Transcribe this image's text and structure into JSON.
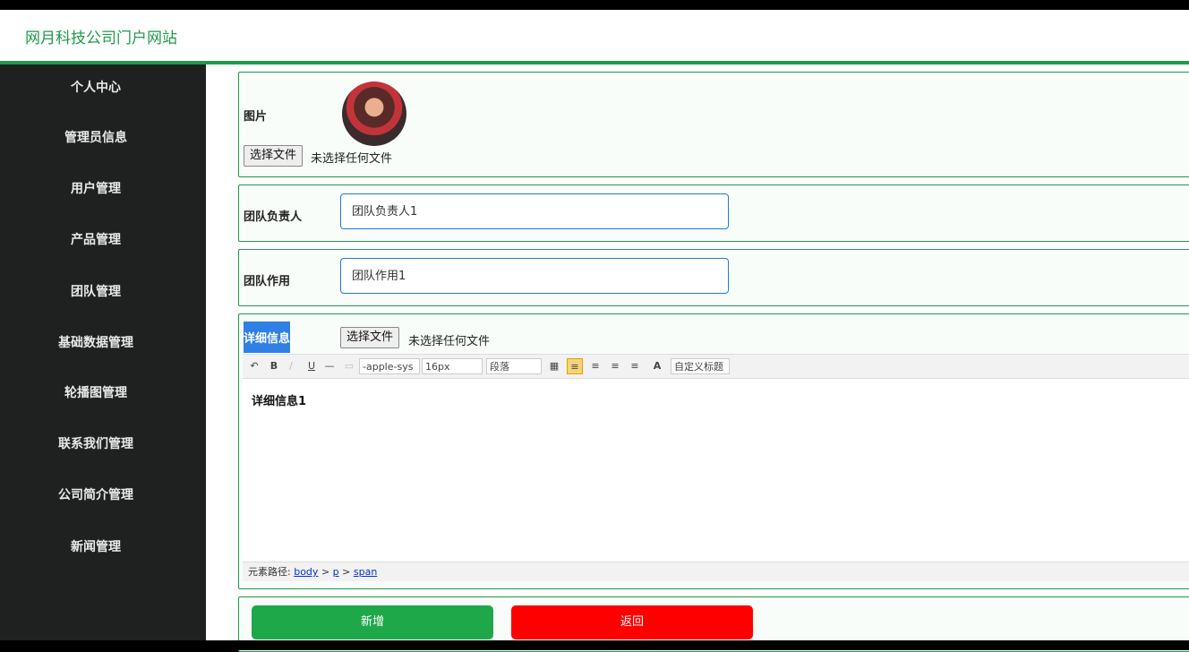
{
  "header": {
    "title": "网月科技公司门户网站"
  },
  "sidebar": {
    "items": [
      {
        "label": "个人中心"
      },
      {
        "label": "管理员信息"
      },
      {
        "label": "用户管理"
      },
      {
        "label": "产品管理"
      },
      {
        "label": "团队管理"
      },
      {
        "label": "基础数据管理"
      },
      {
        "label": "轮播图管理"
      },
      {
        "label": "联系我们管理"
      },
      {
        "label": "公司简介管理"
      },
      {
        "label": "新闻管理"
      }
    ]
  },
  "form": {
    "image": {
      "label": "图片",
      "file_button": "选择文件",
      "file_status": "未选择任何文件"
    },
    "leader": {
      "label": "团队负责人",
      "value": "团队负责人1"
    },
    "role": {
      "label": "团队作用",
      "value": "团队作用1"
    },
    "details": {
      "label": "详细信息",
      "file_button": "选择文件",
      "file_status": "未选择任何文件",
      "toolbar": {
        "font_family": "-apple-sys",
        "font_size": "16px",
        "paragraph": "段落",
        "custom_title": "自定义标题",
        "bold": "B",
        "underline": "U",
        "font_color": "A"
      },
      "content": "详细信息1",
      "path": {
        "label": "元素路径:",
        "body": "body",
        "p": "p",
        "span": "span",
        "sep": ">"
      }
    }
  },
  "actions": {
    "add": "新增",
    "back": "返回"
  },
  "colors": {
    "accent": "#1e9a4a",
    "add": "#1ea84a",
    "back": "#ff0000",
    "sidebar": "#1f2020"
  }
}
